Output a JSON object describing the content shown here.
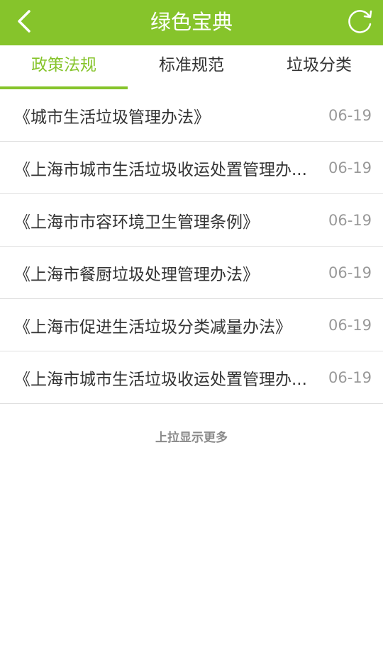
{
  "header": {
    "title": "绿色宝典",
    "back_icon": "chevron-left-icon",
    "refresh_icon": "refresh-icon"
  },
  "tabs": [
    {
      "label": "政策法规",
      "active": true
    },
    {
      "label": "标准规范",
      "active": false
    },
    {
      "label": "垃圾分类",
      "active": false
    }
  ],
  "list": {
    "items": [
      {
        "title": "《城市生活垃圾管理办法》",
        "date": "06-19"
      },
      {
        "title": "《上海市城市生活垃圾收运处置管理办...",
        "date": "06-19"
      },
      {
        "title": "《上海市市容环境卫生管理条例》",
        "date": "06-19"
      },
      {
        "title": "《上海市餐厨垃圾处理管理办法》",
        "date": "06-19"
      },
      {
        "title": "《上海市促进生活垃圾分类减量办法》",
        "date": "06-19"
      },
      {
        "title": "《上海市城市生活垃圾收运处置管理办...",
        "date": "06-19"
      }
    ]
  },
  "footer": {
    "load_more": "上拉显示更多"
  },
  "colors": {
    "accent": "#86c42b",
    "text": "#333333",
    "muted": "#999999"
  }
}
